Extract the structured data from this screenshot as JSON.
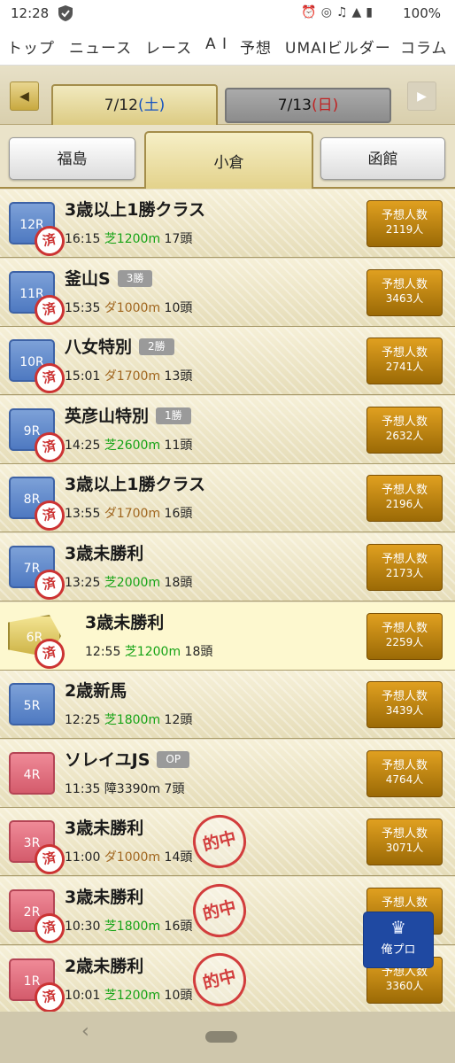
{
  "status": {
    "time": "12:28",
    "battery": "100%"
  },
  "nav": {
    "items": [
      "トップ",
      "ニュース",
      "レース",
      "A I",
      "予想",
      "UMAIビルダー",
      "コラム"
    ]
  },
  "dates": {
    "prev_label": "◀",
    "next_label": "▶",
    "active": {
      "date": "7/12",
      "dow": "(土)"
    },
    "inactive": {
      "date": "7/13",
      "dow": "(日)"
    }
  },
  "venues": {
    "tab1": "福島",
    "tab2": "小倉",
    "tab3": "函館"
  },
  "yoso_label": "予想人数",
  "zumi_label": "済",
  "hit_label": "的中",
  "races": [
    {
      "num": "12R",
      "name": "3歳以上1勝クラス",
      "grade": "",
      "time": "16:15",
      "surface": "芝1200m",
      "heads": "17頭",
      "count": "2119人"
    },
    {
      "num": "11R",
      "name": "釜山S",
      "grade": "3勝",
      "time": "15:35",
      "surface": "ダ1000m",
      "heads": "10頭",
      "count": "3463人"
    },
    {
      "num": "10R",
      "name": "八女特別",
      "grade": "2勝",
      "time": "15:01",
      "surface": "ダ1700m",
      "heads": "13頭",
      "count": "2741人"
    },
    {
      "num": "9R",
      "name": "英彦山特別",
      "grade": "1勝",
      "time": "14:25",
      "surface": "芝2600m",
      "heads": "11頭",
      "count": "2632人"
    },
    {
      "num": "8R",
      "name": "3歳以上1勝クラス",
      "grade": "",
      "time": "13:55",
      "surface": "ダ1700m",
      "heads": "16頭",
      "count": "2196人"
    },
    {
      "num": "7R",
      "name": "3歳未勝利",
      "grade": "",
      "time": "13:25",
      "surface": "芝2000m",
      "heads": "18頭",
      "count": "2173人"
    },
    {
      "num": "6R",
      "name": "3歳未勝利",
      "grade": "",
      "time": "12:55",
      "surface": "芝1200m",
      "heads": "18頭",
      "count": "2259人"
    },
    {
      "num": "5R",
      "name": "2歳新馬",
      "grade": "",
      "time": "12:25",
      "surface": "芝1800m",
      "heads": "12頭",
      "count": "3439人"
    },
    {
      "num": "4R",
      "name": "ソレイユJS",
      "grade": "OP",
      "time": "11:35",
      "surface": "障3390m",
      "heads": "7頭",
      "count": "4764人"
    },
    {
      "num": "3R",
      "name": "3歳未勝利",
      "grade": "",
      "time": "11:00",
      "surface": "ダ1000m",
      "heads": "14頭",
      "count": "3071人"
    },
    {
      "num": "2R",
      "name": "3歳未勝利",
      "grade": "",
      "time": "10:30",
      "surface": "芝1800m",
      "heads": "16頭",
      "count": ""
    },
    {
      "num": "1R",
      "name": "2歳未勝利",
      "grade": "",
      "time": "10:01",
      "surface": "芝1200m",
      "heads": "10頭",
      "count": "3360人"
    }
  ],
  "float_button": {
    "label": "俺プロ",
    "icon": "trophy-icon"
  }
}
